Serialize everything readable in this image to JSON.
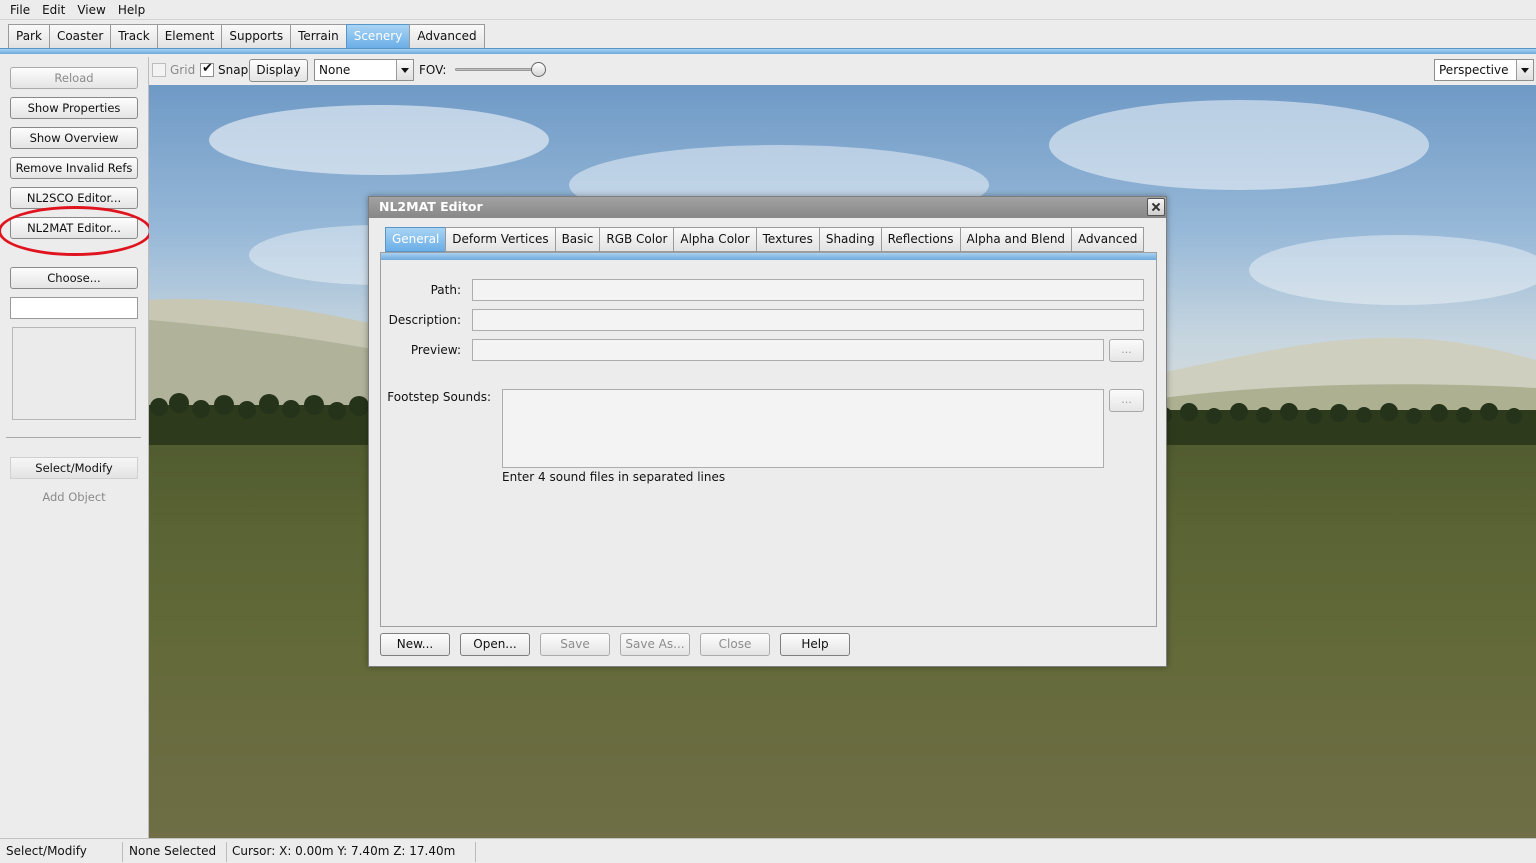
{
  "menu": [
    "File",
    "Edit",
    "View",
    "Help"
  ],
  "main_tabs": [
    {
      "label": "Park"
    },
    {
      "label": "Coaster"
    },
    {
      "label": "Track"
    },
    {
      "label": "Element"
    },
    {
      "label": "Supports"
    },
    {
      "label": "Terrain"
    },
    {
      "label": "Scenery",
      "active": true
    },
    {
      "label": "Advanced"
    }
  ],
  "left_panel": {
    "reload": "Reload",
    "show_properties": "Show Properties",
    "show_overview": "Show Overview",
    "remove_invalid_refs": "Remove Invalid Refs",
    "nl2sco_editor": "NL2SCO Editor...",
    "nl2mat_editor": "NL2MAT Editor...",
    "choose": "Choose...",
    "select_modify": "Select/Modify",
    "add_object": "Add Object"
  },
  "toolbar": {
    "grid_label": "Grid",
    "grid_checked": false,
    "snap_label": "Snap",
    "snap_checked": true,
    "display_button": "Display",
    "snap_mode_value": "None",
    "fov_label": "FOV:",
    "fov_fraction": 0.97,
    "view_mode_value": "Perspective"
  },
  "dialog": {
    "title": "NL2MAT Editor",
    "tabs": [
      {
        "label": "General",
        "active": true
      },
      {
        "label": "Deform Vertices"
      },
      {
        "label": "Basic"
      },
      {
        "label": "RGB Color"
      },
      {
        "label": "Alpha Color"
      },
      {
        "label": "Textures"
      },
      {
        "label": "Shading"
      },
      {
        "label": "Reflections"
      },
      {
        "label": "Alpha and Blend"
      },
      {
        "label": "Advanced"
      }
    ],
    "path_label": "Path:",
    "path_value": "",
    "description_label": "Description:",
    "description_value": "",
    "preview_label": "Preview:",
    "preview_value": "",
    "browse_label": "...",
    "footstep_label": "Footstep Sounds:",
    "footstep_hint": "Enter 4 sound files in separated lines",
    "buttons": {
      "new": "New...",
      "open": "Open...",
      "save": "Save",
      "save_as": "Save As...",
      "close": "Close",
      "help": "Help"
    }
  },
  "status": {
    "mode": "Select/Modify",
    "selection": "None Selected",
    "cursor": "Cursor: X: 0.00m Y: 7.40m Z: 17.40m"
  },
  "colors": {
    "accent": "#6aaee6",
    "highlight_ring": "#e0141e"
  }
}
